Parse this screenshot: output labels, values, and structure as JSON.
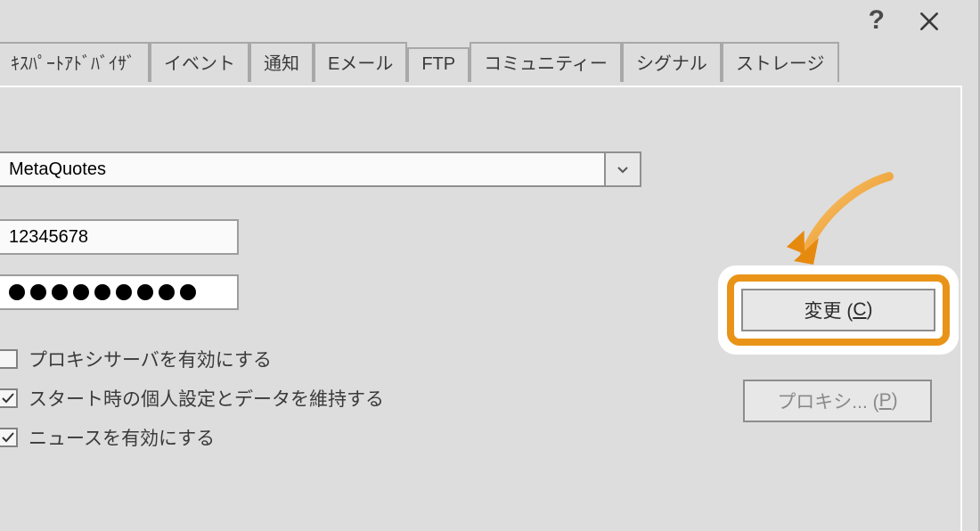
{
  "titlebar": {
    "help": "?",
    "close": "close"
  },
  "tabs": [
    "ｷｽﾊﾟｰﾄｱﾄﾞﾊﾞｲｻﾞ",
    "イベント",
    "通知",
    "Eメール",
    "FTP",
    "コミュニティー",
    "シグナル",
    "ストレージ"
  ],
  "server": {
    "value": "MetaQuotes"
  },
  "login": {
    "value": "12345678"
  },
  "password": {
    "dots": 9
  },
  "change_button": {
    "label_prefix": "変更 (",
    "hotkey": "C",
    "label_suffix": ")"
  },
  "proxy_button": {
    "label_prefix": "プロキシ... (",
    "hotkey": "P",
    "label_suffix": ")"
  },
  "checkboxes": {
    "proxy_enable": {
      "label": "プロキシサーバを有効にする",
      "checked": false
    },
    "keep_personal": {
      "label": "スタート時の個人設定とデータを維持する",
      "checked": true
    },
    "news_enable": {
      "label": "ニュースを有効にする",
      "checked": true
    }
  },
  "colors": {
    "highlight": "#e99418"
  }
}
